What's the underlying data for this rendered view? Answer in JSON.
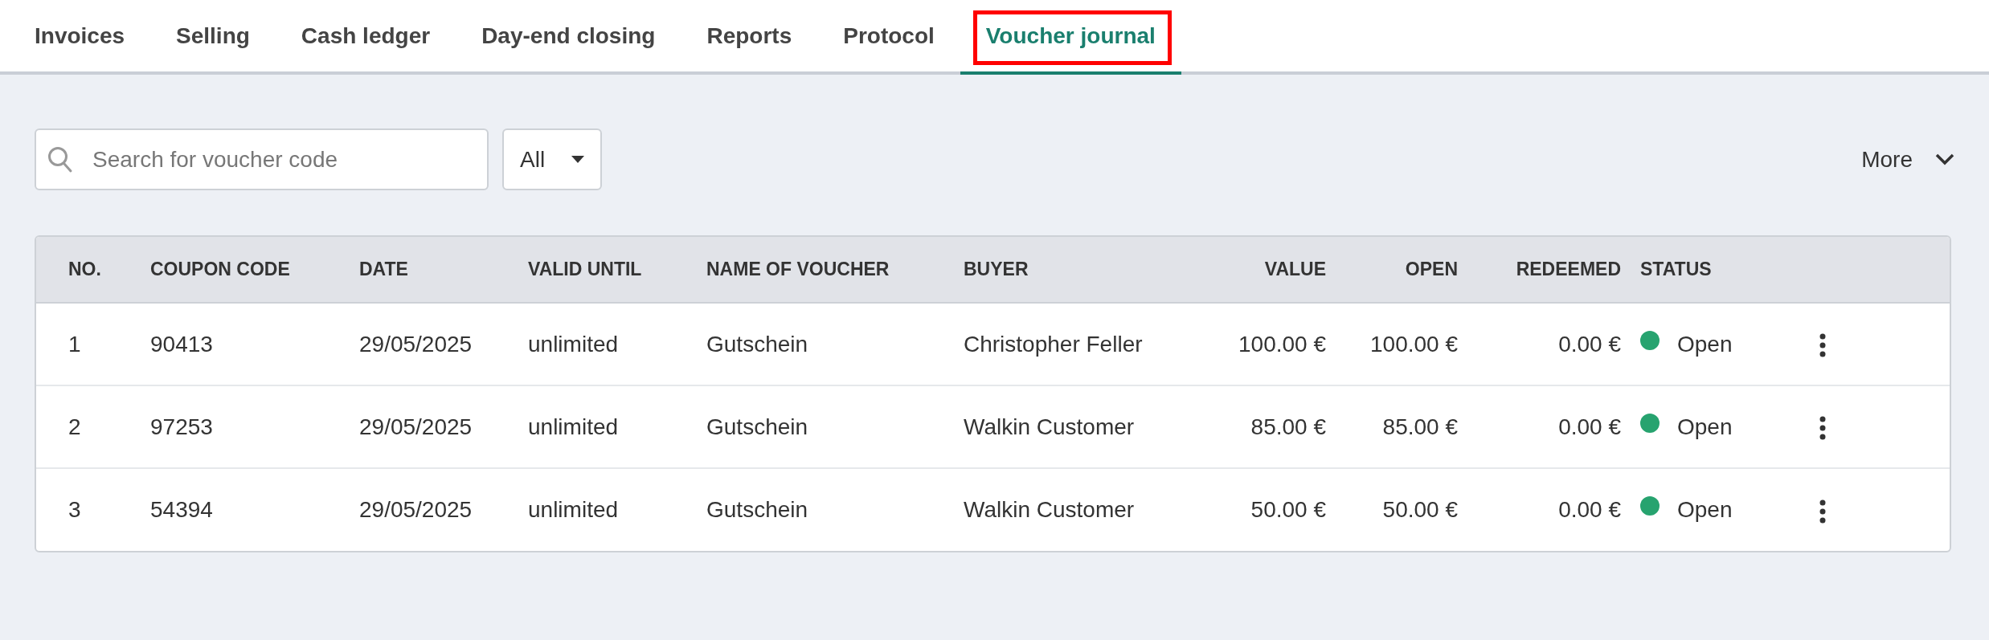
{
  "tabs": [
    {
      "label": "Invoices",
      "selected": false,
      "highlighted": false
    },
    {
      "label": "Selling",
      "selected": false,
      "highlighted": false
    },
    {
      "label": "Cash ledger",
      "selected": false,
      "highlighted": false
    },
    {
      "label": "Day-end closing",
      "selected": false,
      "highlighted": false
    },
    {
      "label": "Reports",
      "selected": false,
      "highlighted": false
    },
    {
      "label": "Protocol",
      "selected": false,
      "highlighted": false
    },
    {
      "label": "Voucher journal",
      "selected": true,
      "highlighted": true
    }
  ],
  "search": {
    "placeholder": "Search for voucher code"
  },
  "filter": {
    "value": "All"
  },
  "more_button": "More",
  "table": {
    "columns": [
      "NO.",
      "COUPON CODE",
      "DATE",
      "VALID UNTIL",
      "NAME OF VOUCHER",
      "BUYER",
      "VALUE",
      "OPEN",
      "REDEEMED",
      "STATUS"
    ],
    "rows": [
      {
        "cells": [
          "1",
          "90413",
          "29/05/2025",
          "unlimited",
          "Gutschein",
          "Christopher Feller",
          "100.00 €",
          "100.00 €",
          "0.00 €"
        ],
        "status": "Open",
        "color": "#27a36f"
      },
      {
        "cells": [
          "2",
          "97253",
          "29/05/2025",
          "unlimited",
          "Gutschein",
          "Walkin Customer",
          "85.00 €",
          "85.00 €",
          "0.00 €"
        ],
        "status": "Open",
        "color": "#27a36f"
      },
      {
        "cells": [
          "3",
          "54394",
          "29/05/2025",
          "unlimited",
          "Gutschein",
          "Walkin Customer",
          "50.00 €",
          "50.00 €",
          "0.00 €"
        ],
        "status": "Open",
        "color": "#27a36f"
      }
    ]
  }
}
